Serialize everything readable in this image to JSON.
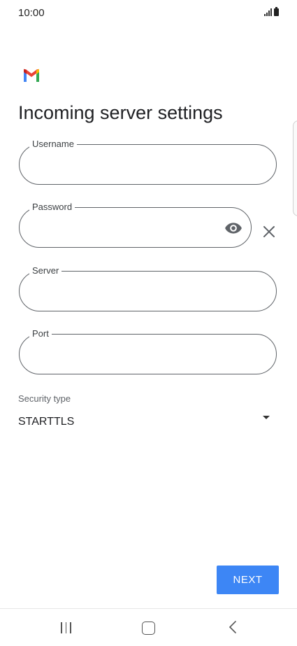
{
  "status": {
    "time": "10:00"
  },
  "app": {
    "logo": "gmail-logo"
  },
  "header": {
    "title": "Incoming server settings"
  },
  "form": {
    "username": {
      "label": "Username",
      "value": ""
    },
    "password": {
      "label": "Password",
      "value": ""
    },
    "server": {
      "label": "Server",
      "value": ""
    },
    "port": {
      "label": "Port",
      "value": ""
    },
    "security": {
      "label": "Security type",
      "value": "STARTTLS"
    }
  },
  "actions": {
    "next_label": "NEXT"
  },
  "colors": {
    "accent": "#3d86f5",
    "outline": "#5f6368"
  },
  "icons": [
    "signal-icon",
    "battery-icon",
    "gmail-logo",
    "eye-icon",
    "close-icon",
    "dropdown-arrow-icon",
    "recent-apps-icon",
    "home-icon",
    "back-icon"
  ]
}
